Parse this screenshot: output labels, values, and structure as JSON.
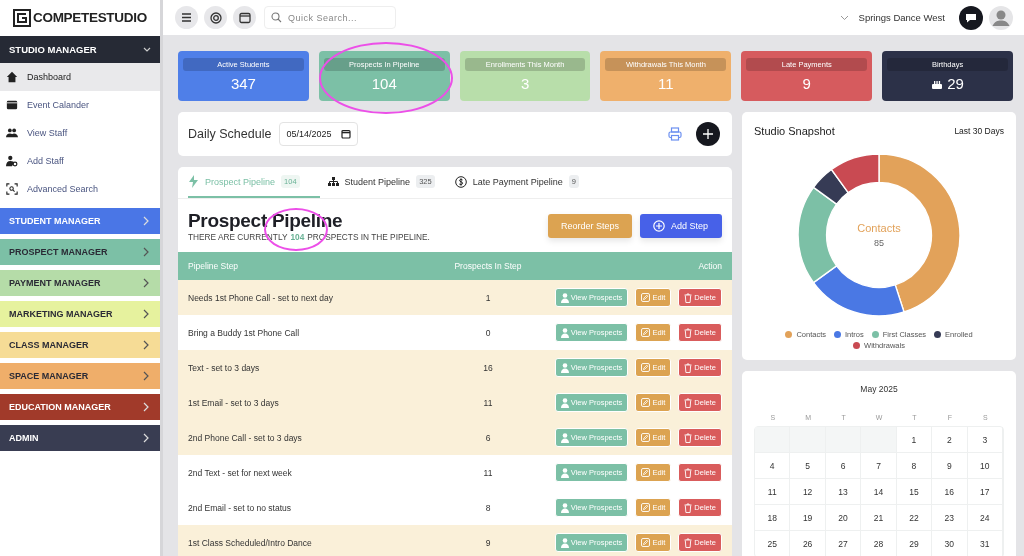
{
  "header": {
    "logo": "COMPETESTUDIO",
    "search": {
      "placeholder": "Quick Search..."
    },
    "studio": "Springs Dance West"
  },
  "sidebar": {
    "section": {
      "label": "STUDIO MANAGER",
      "expanded": true
    },
    "items": [
      {
        "label": "Dashboard",
        "selected": true
      },
      {
        "label": "Event Calander",
        "selected": false
      },
      {
        "label": "View Staff",
        "selected": false
      },
      {
        "label": "Add Staff",
        "selected": false
      },
      {
        "label": "Advanced Search",
        "selected": false
      }
    ],
    "managers": [
      {
        "label": "STUDENT MANAGER",
        "color": "#4a76e6"
      },
      {
        "label": "PROSPECT MANAGER",
        "color": "#7cc0a6"
      },
      {
        "label": "PAYMENT MANAGER",
        "color": "#b5dca8"
      },
      {
        "label": "MARKETING MANAGER",
        "color": "#e6f29e"
      },
      {
        "label": "CLASS MANAGER",
        "color": "#f6dc96"
      },
      {
        "label": "SPACE MANAGER",
        "color": "#efae6a"
      },
      {
        "label": "EDUCATION MANAGER",
        "color": "#a13a2a"
      },
      {
        "label": "ADMIN",
        "color": "#393d52"
      }
    ]
  },
  "stats": [
    {
      "kind": "count",
      "label": "Active Students",
      "value": "347",
      "color": "#4f7fe8",
      "circled": false
    },
    {
      "kind": "count",
      "label": "Prospects In Pipeline",
      "value": "104",
      "color": "#7cc0a6",
      "circled": true
    },
    {
      "kind": "count",
      "label": "Enrollments This Month",
      "value": "3",
      "color": "#b8deaa",
      "circled": false
    },
    {
      "kind": "count",
      "label": "Withdrawals This Month",
      "value": "11",
      "color": "#efb06c",
      "circled": false
    },
    {
      "kind": "count",
      "label": "Late Payments",
      "value": "9",
      "color": "#d65b5e",
      "circled": false
    },
    {
      "kind": "birthday",
      "label": "Birthdays",
      "value": "29",
      "color": "#2c3148",
      "circled": false
    }
  ],
  "schedule": {
    "title": "Daily Schedule",
    "date": "05/14/2025"
  },
  "tabs": [
    {
      "label": "Prospect Pipeline",
      "count": "104",
      "selected": true
    },
    {
      "label": "Student Pipeline",
      "count": "325",
      "selected": false
    },
    {
      "label": "Late Payment Pipeline",
      "count": "9",
      "selected": false
    }
  ],
  "pipeline": {
    "title": "Prospect Pipeline",
    "summary_before": "THERE ARE CURRENTLY",
    "count": "104",
    "summary_after": "PROSPECTS IN THE PIPELINE.",
    "count_circled": true,
    "buttons": [
      {
        "kind": "reorder",
        "label": "Reorder Steps"
      },
      {
        "kind": "add",
        "label": "Add Step"
      }
    ]
  },
  "table": {
    "columns": [
      "Pipeline Step",
      "Prospects In Step",
      "Action"
    ],
    "rows": [
      {
        "step": "Needs 1st Phone Call - set to next day",
        "count": "1",
        "highlighted": true,
        "actions": [
          {
            "kind": "view",
            "label": "View Prospects"
          },
          {
            "kind": "edit",
            "label": "Edit"
          },
          {
            "kind": "delete",
            "label": "Delete"
          }
        ]
      },
      {
        "step": "Bring a Buddy 1st Phone Call",
        "count": "0",
        "highlighted": false,
        "actions": [
          {
            "kind": "view",
            "label": "View Prospects"
          },
          {
            "kind": "edit",
            "label": "Edit"
          },
          {
            "kind": "delete",
            "label": "Delete"
          }
        ]
      },
      {
        "step": "Text - set to 3 days",
        "count": "16",
        "highlighted": true,
        "actions": [
          {
            "kind": "view",
            "label": "View Prospects"
          },
          {
            "kind": "edit",
            "label": "Edit"
          },
          {
            "kind": "delete",
            "label": "Delete"
          }
        ]
      },
      {
        "step": "1st Email - set to 3 days",
        "count": "11",
        "highlighted": true,
        "actions": [
          {
            "kind": "view",
            "label": "View Prospects"
          },
          {
            "kind": "edit",
            "label": "Edit"
          },
          {
            "kind": "delete",
            "label": "Delete"
          }
        ]
      },
      {
        "step": "2nd Phone Call - set to 3 days",
        "count": "6",
        "highlighted": true,
        "actions": [
          {
            "kind": "view",
            "label": "View Prospects"
          },
          {
            "kind": "edit",
            "label": "Edit"
          },
          {
            "kind": "delete",
            "label": "Delete"
          }
        ]
      },
      {
        "step": "2nd Text - set for next week",
        "count": "11",
        "highlighted": false,
        "actions": [
          {
            "kind": "view",
            "label": "View Prospects"
          },
          {
            "kind": "edit",
            "label": "Edit"
          },
          {
            "kind": "delete",
            "label": "Delete"
          }
        ]
      },
      {
        "step": "2nd Email - set to no status",
        "count": "8",
        "highlighted": false,
        "actions": [
          {
            "kind": "view",
            "label": "View Prospects"
          },
          {
            "kind": "edit",
            "label": "Edit"
          },
          {
            "kind": "delete",
            "label": "Delete"
          }
        ]
      },
      {
        "step": "1st Class Scheduled/Intro Dance",
        "count": "9",
        "highlighted": true,
        "actions": [
          {
            "kind": "view",
            "label": "View Prospects"
          },
          {
            "kind": "edit",
            "label": "Edit"
          },
          {
            "kind": "delete",
            "label": "Delete"
          }
        ]
      }
    ]
  },
  "snapshot": {
    "title": "Studio Snapshot",
    "period": "Last 30 Days",
    "center_label": "Contacts",
    "center_value": "85",
    "legend": [
      {
        "label": "Contacts",
        "color": "#e2a25a"
      },
      {
        "label": "Intros",
        "color": "#4a78e4"
      },
      {
        "label": "First Classes",
        "color": "#7cc0a6"
      },
      {
        "label": "Enrolled",
        "color": "#363b55"
      },
      {
        "label": "Withdrawals",
        "color": "#c94a52"
      }
    ]
  },
  "calendar": {
    "month": "May 2025",
    "weekdays": [
      "S",
      "M",
      "T",
      "W",
      "T",
      "F",
      "S"
    ],
    "weeks": [
      [
        {
          "kind": "blank"
        },
        {
          "kind": "blank"
        },
        {
          "kind": "blank"
        },
        {
          "kind": "blank"
        },
        {
          "kind": "day",
          "day": "1"
        },
        {
          "kind": "day",
          "day": "2"
        },
        {
          "kind": "day",
          "day": "3"
        }
      ],
      [
        {
          "kind": "day",
          "day": "4"
        },
        {
          "kind": "day",
          "day": "5"
        },
        {
          "kind": "day",
          "day": "6"
        },
        {
          "kind": "day",
          "day": "7"
        },
        {
          "kind": "day",
          "day": "8"
        },
        {
          "kind": "day",
          "day": "9"
        },
        {
          "kind": "day",
          "day": "10"
        }
      ],
      [
        {
          "kind": "day",
          "day": "11"
        },
        {
          "kind": "day",
          "day": "12"
        },
        {
          "kind": "day",
          "day": "13"
        },
        {
          "kind": "day",
          "day": "14"
        },
        {
          "kind": "day",
          "day": "15"
        },
        {
          "kind": "day",
          "day": "16"
        },
        {
          "kind": "day",
          "day": "17"
        }
      ],
      [
        {
          "kind": "day",
          "day": "18"
        },
        {
          "kind": "day",
          "day": "19"
        },
        {
          "kind": "day",
          "day": "20"
        },
        {
          "kind": "day",
          "day": "21"
        },
        {
          "kind": "day",
          "day": "22"
        },
        {
          "kind": "day",
          "day": "23"
        },
        {
          "kind": "day",
          "day": "24"
        }
      ],
      [
        {
          "kind": "day",
          "day": "25"
        },
        {
          "kind": "day",
          "day": "26"
        },
        {
          "kind": "day",
          "day": "27"
        },
        {
          "kind": "day",
          "day": "28"
        },
        {
          "kind": "day",
          "day": "29"
        },
        {
          "kind": "day",
          "day": "30"
        },
        {
          "kind": "day",
          "day": "31"
        }
      ]
    ]
  }
}
